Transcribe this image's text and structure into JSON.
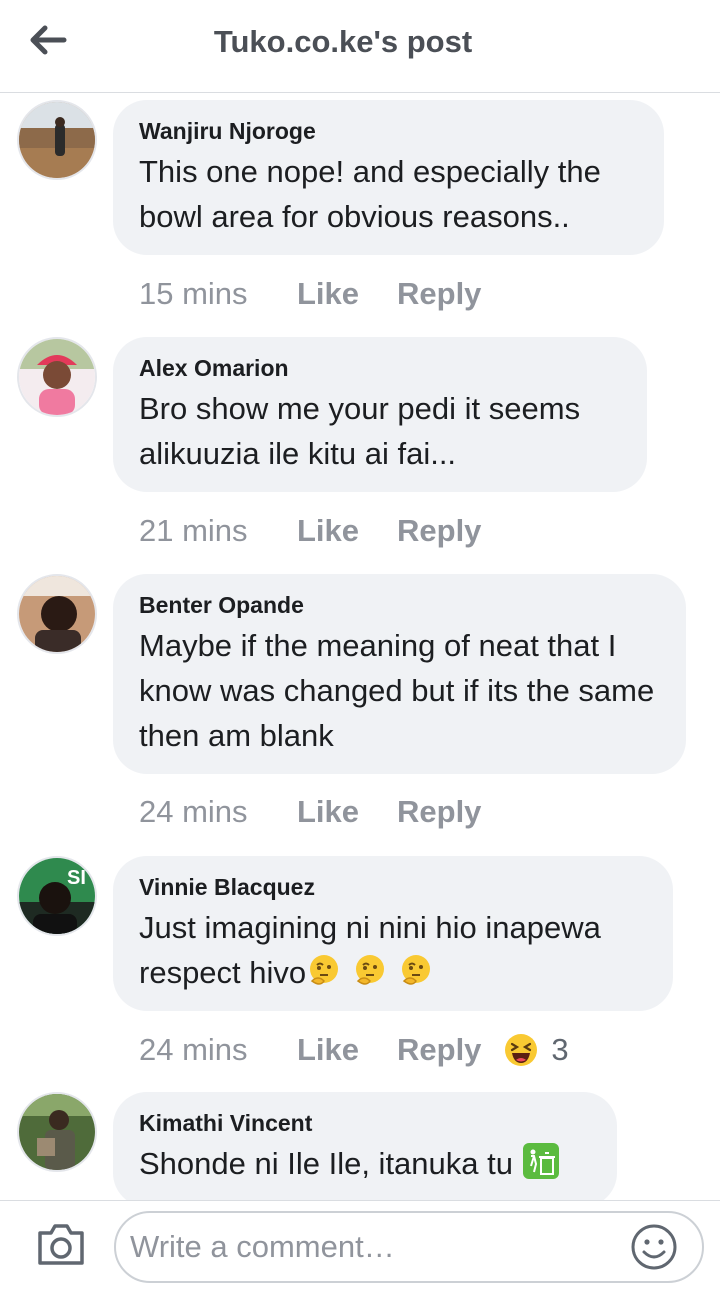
{
  "header": {
    "title": "Tuko.co.ke's post"
  },
  "comments": [
    {
      "author": "Wanjiru Njoroge",
      "text": "This one nope! and especially the bowl area for obvious reasons..",
      "time": "15 mins",
      "like": "Like",
      "reply": "Reply"
    },
    {
      "author": "Alex Omarion",
      "text": "Bro show me your pedi it seems alikuuzia ile kitu ai fai...",
      "time": "21 mins",
      "like": "Like",
      "reply": "Reply"
    },
    {
      "author": "Benter Opande",
      "text": "Maybe if the meaning of neat that I know was changed but if its the same then am blank",
      "time": "24 mins",
      "like": "Like",
      "reply": "Reply"
    },
    {
      "author": "Vinnie Blacquez",
      "text": "Just imagining ni nini hio inapewa respect hivo",
      "emojis": [
        "thinking-face",
        "thinking-face",
        "thinking-face"
      ],
      "time": "24 mins",
      "like": "Like",
      "reply": "Reply",
      "reaction": {
        "icon": "laughing-face",
        "count": "3"
      }
    },
    {
      "author": "Kimathi Vincent",
      "text": "Shonde ni Ile Ile, itanuka tu",
      "emojis": [
        "trash-can-emoji"
      ]
    }
  ],
  "composer": {
    "placeholder": "Write a comment…"
  },
  "colors": {
    "bubble": "#f0f2f5",
    "meta": "#90949c",
    "title": "#4b4f56"
  }
}
